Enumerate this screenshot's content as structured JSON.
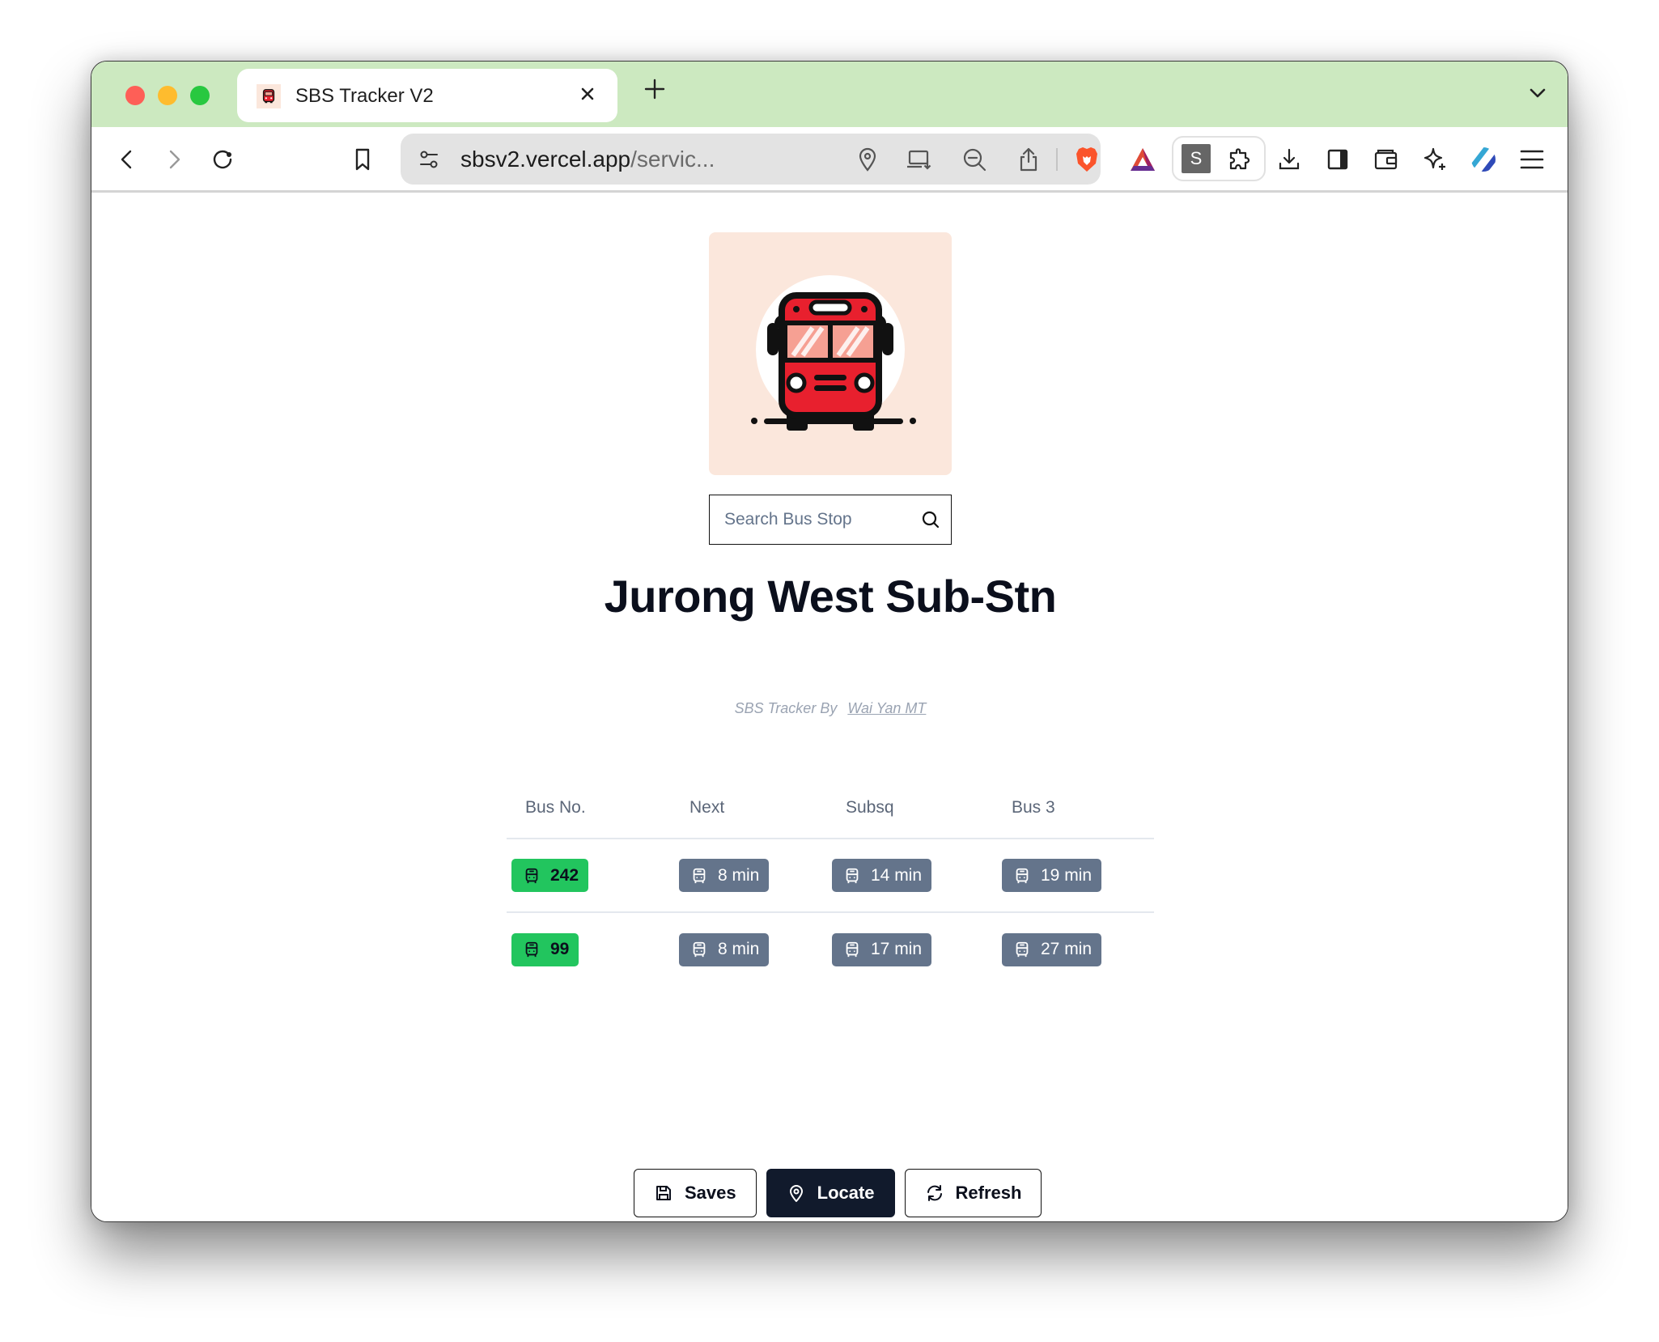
{
  "browser": {
    "tab": {
      "title": "SBS Tracker V2",
      "close_icon": "close-icon",
      "favicon": "bus-favicon"
    },
    "new_tab_label": "+",
    "url": {
      "host": "sbsv2.vercel.app",
      "path": "/servic..."
    },
    "toolbar_icons": [
      "back-icon",
      "forward-icon",
      "reload-icon",
      "bookmark-icon",
      "site-settings-icon",
      "location-icon",
      "install-app-icon",
      "zoom-out-icon",
      "share-icon",
      "brave-shields-icon",
      "brave-rewards-icon",
      "extension-s-icon",
      "extensions-puzzle-icon",
      "download-icon",
      "sidebar-icon",
      "wallet-icon",
      "leo-ai-icon",
      "vpn-icon",
      "menu-icon"
    ],
    "extension_s_label": "S"
  },
  "page": {
    "logo_alt": "Red bus illustration",
    "search": {
      "placeholder": "Search Bus Stop",
      "value": ""
    },
    "station_name": "Jurong West Sub-Stn",
    "credit": {
      "prefix": "SBS Tracker By",
      "author": "Wai Yan MT"
    },
    "table": {
      "headers": [
        "Bus No.",
        "Next",
        "Subsq",
        "Bus 3"
      ],
      "rows": [
        {
          "bus": "242",
          "next": "8 min",
          "subsq": "14 min",
          "bus3": "19 min"
        },
        {
          "bus": "99",
          "next": "8 min",
          "subsq": "17 min",
          "bus3": "27 min"
        }
      ]
    },
    "actions": {
      "saves": "Saves",
      "locate": "Locate",
      "refresh": "Refresh"
    },
    "colors": {
      "route_badge": "#22c55e",
      "eta_badge": "#64748b",
      "primary_button": "#111a2c",
      "tabstrip": "#cce9c0"
    }
  }
}
